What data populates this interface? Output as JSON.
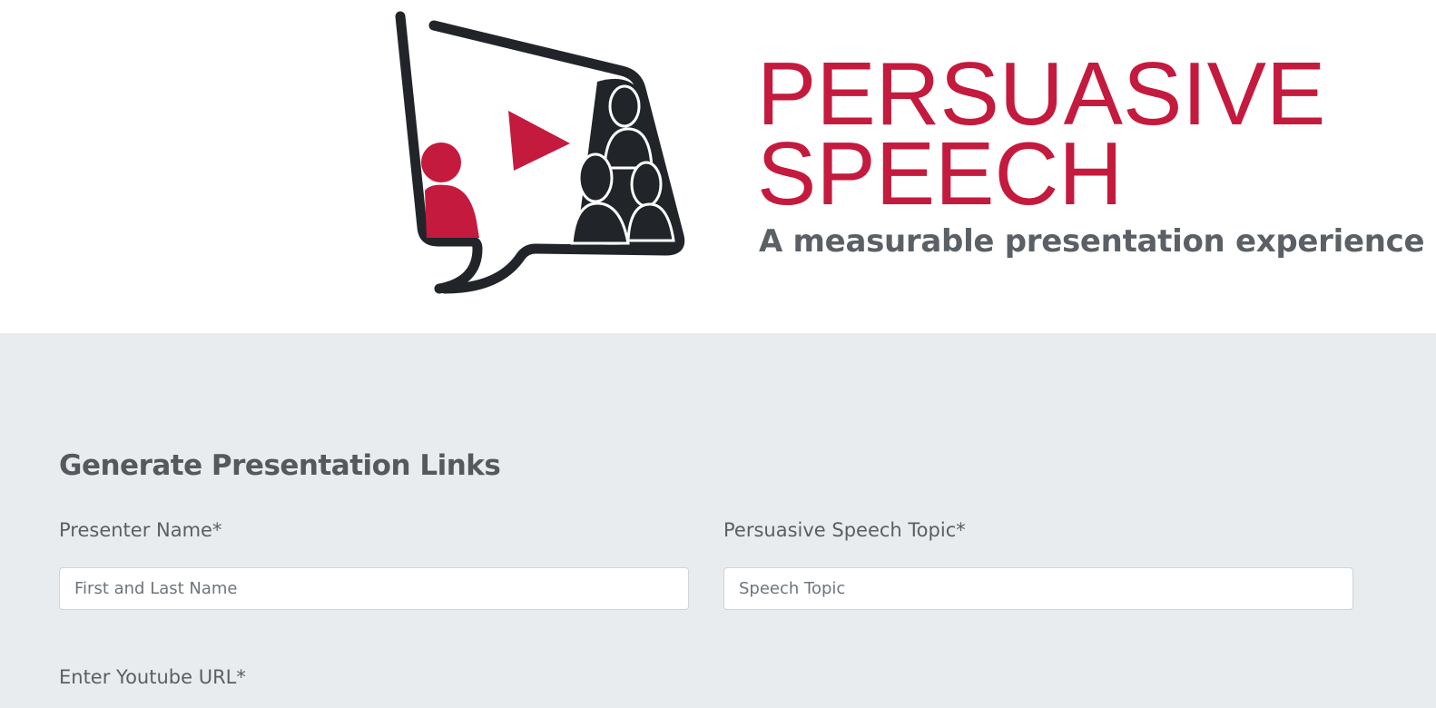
{
  "header": {
    "brand_line_1": "PERSUASIVE",
    "brand_line_2": "SPEECH",
    "tagline": "A measurable presentation experience",
    "logo_icon": "speech-bubble-presentation-logo",
    "colors": {
      "brand_red": "#c41a3e",
      "dark": "#212529",
      "tagline_gray": "#5b6066"
    }
  },
  "form": {
    "title": "Generate Presentation Links",
    "presenter_name": {
      "label": "Presenter Name*",
      "placeholder": "First and Last Name",
      "value": ""
    },
    "speech_topic": {
      "label": "Persuasive Speech Topic*",
      "placeholder": "Speech Topic",
      "value": ""
    },
    "youtube_url": {
      "label": "Enter Youtube URL*"
    },
    "colors": {
      "background": "#e9ecef",
      "input_border": "#ced4da"
    }
  }
}
